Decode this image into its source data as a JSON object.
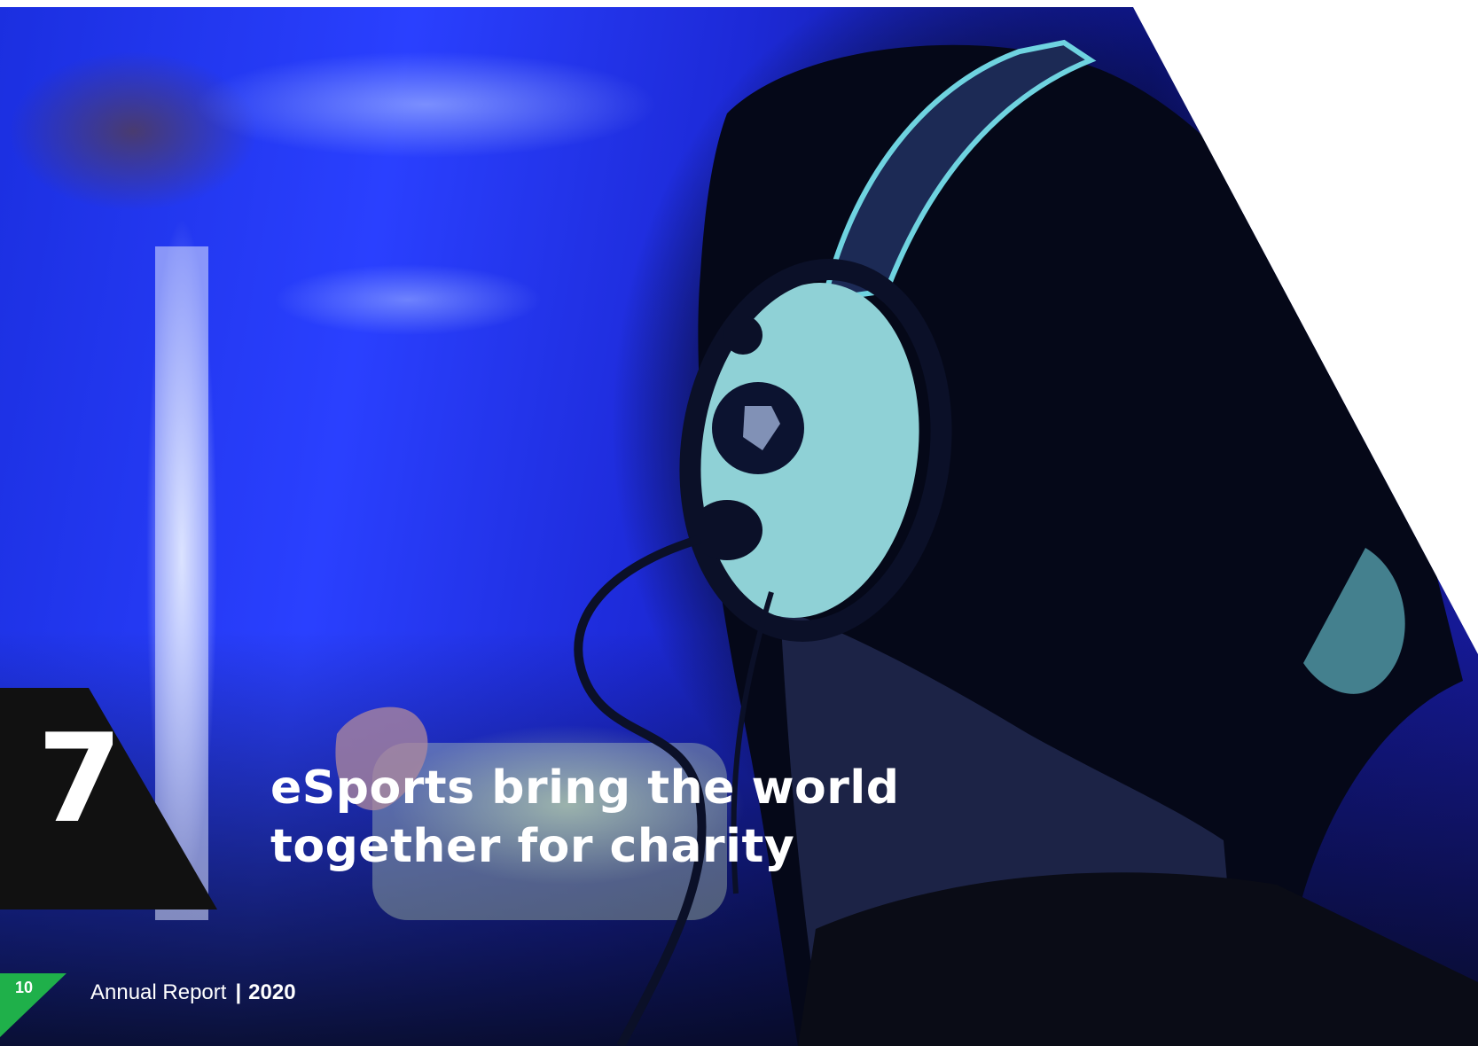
{
  "chapter": {
    "number": "7",
    "headline_line1": "eSports bring the world",
    "headline_line2": "together for charity"
  },
  "photo": {
    "subject": "esports player wearing headset"
  },
  "footer": {
    "page_number": "10",
    "report_label": "Annual Report",
    "separator": "|",
    "year": "2020"
  },
  "colors": {
    "accent_green": "#1fb04a",
    "block_black": "#111111",
    "photo_blue": "#1f33e6"
  }
}
